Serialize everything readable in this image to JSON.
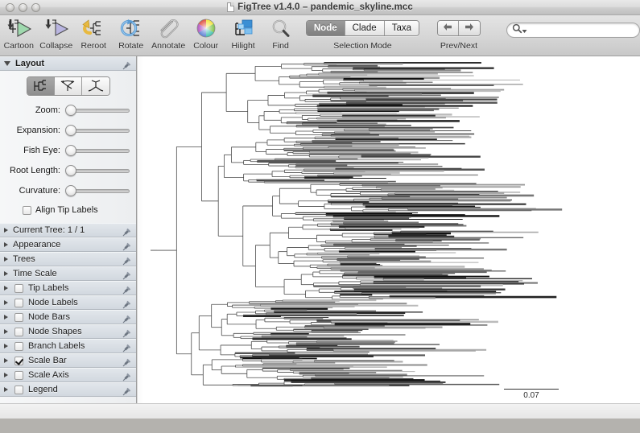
{
  "window": {
    "title": "FigTree v1.4.0 – pandemic_skyline.mcc",
    "doc_icon": "document-icon",
    "traffic_lights": [
      "close-button",
      "minimize-button",
      "zoom-button"
    ]
  },
  "toolbar": {
    "items": [
      {
        "label": "Cartoon",
        "icon": "cartoon-icon"
      },
      {
        "label": "Collapse",
        "icon": "collapse-icon"
      },
      {
        "label": "Reroot",
        "icon": "reroot-icon"
      },
      {
        "label": "Rotate",
        "icon": "rotate-icon"
      },
      {
        "label": "Annotate",
        "icon": "paperclip-icon"
      },
      {
        "label": "Colour",
        "icon": "colour-wheel-icon"
      },
      {
        "label": "Hilight",
        "icon": "highlight-icon"
      },
      {
        "label": "Find",
        "icon": "magnifier-icon"
      }
    ],
    "selection_mode": {
      "caption": "Selection Mode",
      "options": [
        "Node",
        "Clade",
        "Taxa"
      ],
      "selected": "Node"
    },
    "prev_next": {
      "caption": "Prev/Next",
      "prev_icon": "arrow-left-icon",
      "next_icon": "arrow-right-icon"
    },
    "search": {
      "value": "",
      "placeholder": "",
      "icon": "search-icon",
      "dropdown_icon": "chevron-down-icon"
    }
  },
  "sidebar": {
    "layout": {
      "title": "Layout",
      "expanded": true,
      "pin_icon": "pin-icon",
      "modes": [
        {
          "name": "rectangular-layout",
          "selected": true
        },
        {
          "name": "polar-layout",
          "selected": false
        },
        {
          "name": "radial-layout",
          "selected": false
        }
      ],
      "sliders": [
        {
          "label": "Zoom:",
          "value": 0
        },
        {
          "label": "Expansion:",
          "value": 0
        },
        {
          "label": "Fish Eye:",
          "value": 0
        },
        {
          "label": "Root Length:",
          "value": 0
        },
        {
          "label": "Curvature:",
          "value": 0
        }
      ],
      "align_tip_labels": {
        "label": "Align Tip Labels",
        "checked": false
      }
    },
    "sections": [
      {
        "title": "Current Tree: 1 / 1",
        "checkbox": false,
        "checked": false,
        "pin_icon": "pin-icon"
      },
      {
        "title": "Appearance",
        "checkbox": false,
        "checked": false,
        "pin_icon": "pin-icon"
      },
      {
        "title": "Trees",
        "checkbox": false,
        "checked": false,
        "pin_icon": "pin-icon"
      },
      {
        "title": "Time Scale",
        "checkbox": false,
        "checked": false,
        "pin_icon": "pin-icon"
      },
      {
        "title": "Tip Labels",
        "checkbox": true,
        "checked": false,
        "pin_icon": "pin-icon"
      },
      {
        "title": "Node Labels",
        "checkbox": true,
        "checked": false,
        "pin_icon": "pin-icon"
      },
      {
        "title": "Node Bars",
        "checkbox": true,
        "checked": false,
        "pin_icon": "pin-icon"
      },
      {
        "title": "Node Shapes",
        "checkbox": true,
        "checked": false,
        "pin_icon": "pin-icon"
      },
      {
        "title": "Branch Labels",
        "checkbox": true,
        "checked": false,
        "pin_icon": "pin-icon"
      },
      {
        "title": "Scale Bar",
        "checkbox": true,
        "checked": true,
        "pin_icon": "pin-icon"
      },
      {
        "title": "Scale Axis",
        "checkbox": true,
        "checked": false,
        "pin_icon": "pin-icon"
      },
      {
        "title": "Legend",
        "checkbox": true,
        "checked": false,
        "pin_icon": "pin-icon"
      }
    ]
  },
  "tree": {
    "scale_bar_label": "0.07",
    "layout_type": "rectangular",
    "description": "Dense maximum-clade-credibility phylogeny with several hundred tips, branches shaded grey to black"
  },
  "colors": {
    "toolbar_bg": "#d7d7d7",
    "sidebar_bg": "#eceef0",
    "panel_header": "#d2d8df",
    "tree_line": "#333333",
    "accent_selected": "#7f7f7f",
    "desktop": "#b4b2ae"
  }
}
